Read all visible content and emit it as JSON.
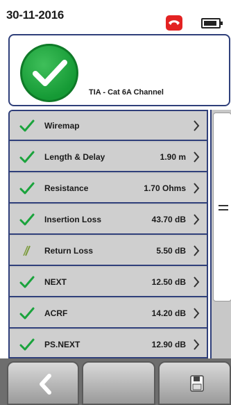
{
  "status_bar": {
    "date": "30-11-2016",
    "battery_level": 0.9
  },
  "header": {
    "result": "pass",
    "standard": "TIA - Cat 6A Channel"
  },
  "results": [
    {
      "label": "Wiremap",
      "value": "",
      "status": "pass"
    },
    {
      "label": "Length & Delay",
      "value": "1.90 m",
      "status": "pass"
    },
    {
      "label": "Resistance",
      "value": "1.70 Ohms",
      "status": "pass"
    },
    {
      "label": "Insertion Loss",
      "value": "43.70 dB",
      "status": "pass"
    },
    {
      "label": "Return Loss",
      "value": "5.50 dB",
      "status": "na"
    },
    {
      "label": "NEXT",
      "value": "12.50 dB",
      "status": "pass"
    },
    {
      "label": "ACRF",
      "value": "14.20 dB",
      "status": "pass"
    },
    {
      "label": "PS.NEXT",
      "value": "12.90 dB",
      "status": "pass"
    }
  ],
  "toolbar": {
    "back_icon": "back-chevron-icon",
    "save_icon": "save-icon"
  },
  "colors": {
    "pass_green": "#1aa33c",
    "frame_blue": "#2f3f7a",
    "phone_red": "#e32222"
  }
}
